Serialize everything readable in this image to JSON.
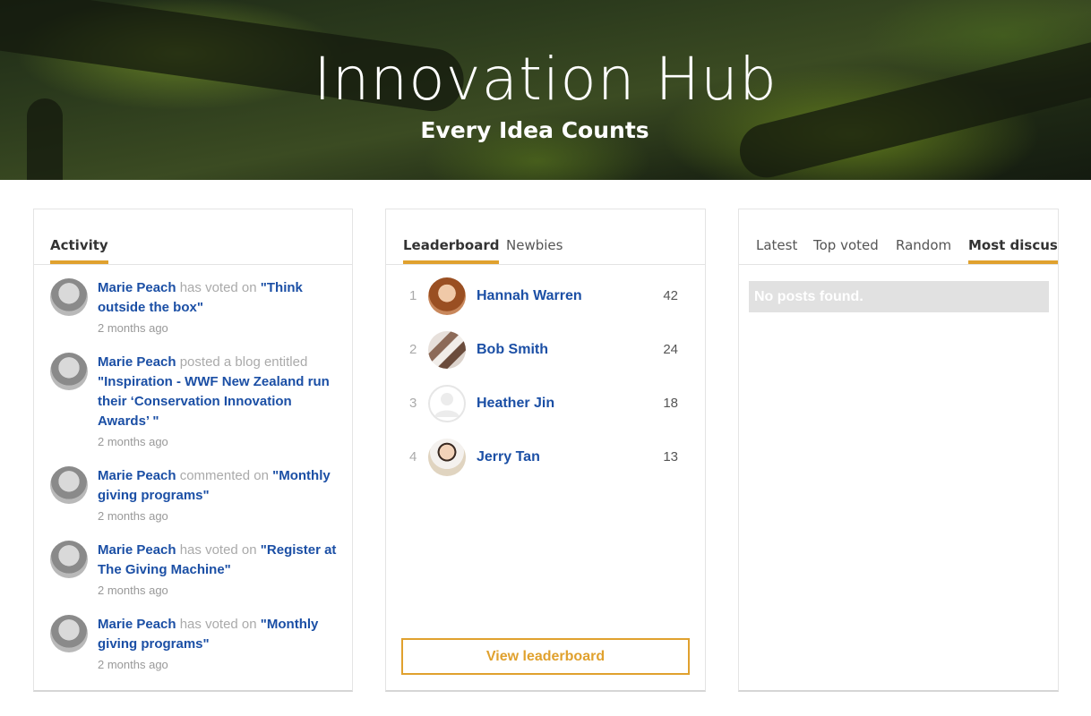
{
  "hero": {
    "title": "Innovation Hub",
    "subtitle": "Every Idea Counts"
  },
  "activity": {
    "tab_label": "Activity",
    "items": [
      {
        "user": "Marie Peach",
        "action": " has voted on ",
        "target": "\"Think outside the box\"",
        "time": "2 months ago"
      },
      {
        "user": "Marie Peach",
        "action": " posted a blog entitled ",
        "target": "\"Inspiration - WWF New Zealand run their ‘Conservation Innovation Awards’ \"",
        "time": "2 months ago"
      },
      {
        "user": "Marie Peach",
        "action": " commented on ",
        "target": "\"Monthly giving programs\"",
        "time": "2 months ago"
      },
      {
        "user": "Marie Peach",
        "action": " has voted on ",
        "target": "\"Register at The Giving Machine\"",
        "time": "2 months ago"
      },
      {
        "user": "Marie Peach",
        "action": " has voted on ",
        "target": "\"Monthly giving programs\"",
        "time": "2 months ago"
      }
    ]
  },
  "leaderboard": {
    "tabs": [
      "Leaderboard",
      "Newbies"
    ],
    "rows": [
      {
        "rank": "1",
        "name": "Hannah Warren",
        "score": "42"
      },
      {
        "rank": "2",
        "name": "Bob Smith",
        "score": "24"
      },
      {
        "rank": "3",
        "name": "Heather Jin",
        "score": "18"
      },
      {
        "rank": "4",
        "name": "Jerry Tan",
        "score": "13"
      }
    ],
    "button_label": "View leaderboard"
  },
  "posts": {
    "tabs": [
      "Latest",
      "Top voted",
      "Random",
      "Most discusse"
    ],
    "empty_message": "No posts found."
  },
  "colors": {
    "accent": "#e0a12e",
    "link": "#1b4fa5"
  }
}
